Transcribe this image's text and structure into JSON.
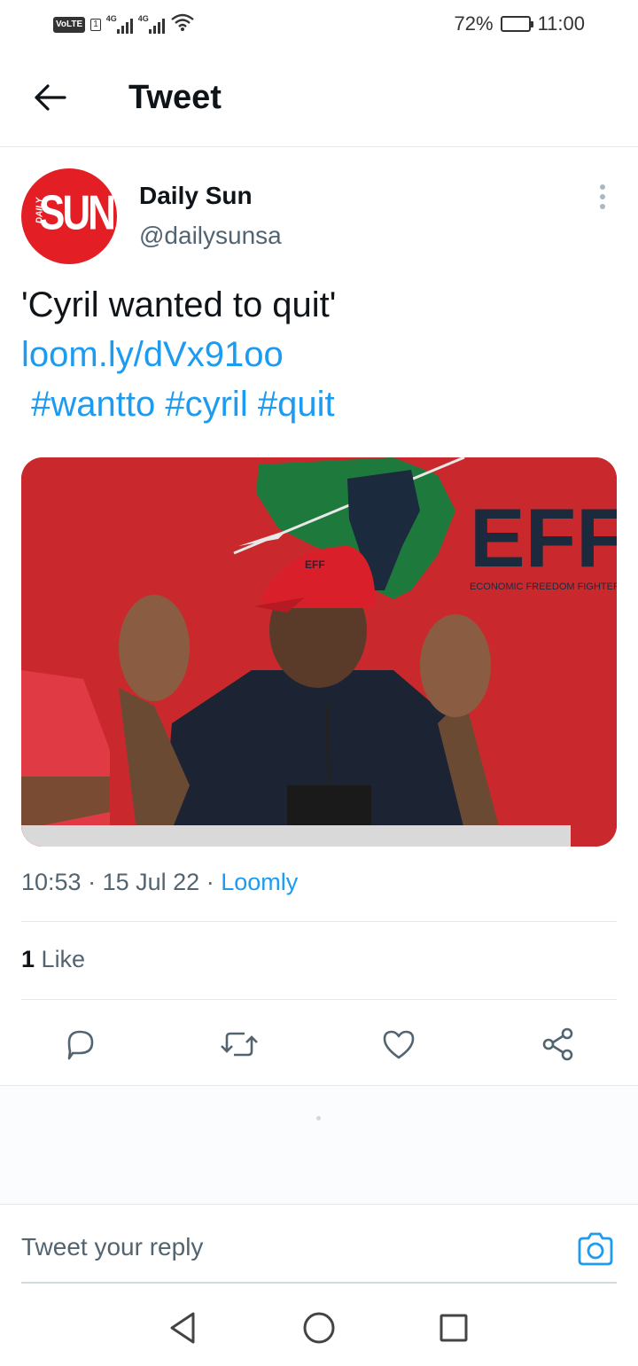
{
  "status_bar": {
    "volte": "VoLTE",
    "sim": "1",
    "net1": "4G",
    "net2": "4G",
    "battery": "72%",
    "battery_level": 0.72,
    "time": "11:00"
  },
  "header": {
    "title": "Tweet"
  },
  "author": {
    "avatar_top": "DAILY",
    "avatar_main": "SUN",
    "name": "Daily Sun",
    "handle": "@dailysunsa"
  },
  "tweet": {
    "text": "'Cyril wanted to quit'",
    "link": "loom.ly/dVx91oo",
    "hashtags": [
      "#wantto",
      "#cyril",
      "#quit"
    ],
    "image": {
      "banner_text": "EFF",
      "banner_subtext": "ECONOMIC FREEDOM FIGHTERS",
      "cap_text": "EFF"
    }
  },
  "meta": {
    "time": "10:53",
    "date": "15 Jul 22",
    "dot": "·",
    "source": "Loomly"
  },
  "engagement": {
    "like_count": "1",
    "like_label": "Like"
  },
  "actions": [
    "reply-icon",
    "retweet-icon",
    "like-icon",
    "share-icon"
  ],
  "reply": {
    "placeholder": "Tweet your reply"
  },
  "nav": [
    "back-triangle-icon",
    "home-circle-icon",
    "recents-square-icon"
  ],
  "colors": {
    "accent": "#1d9bf0",
    "brand_red": "#e31e24",
    "muted": "#536471"
  }
}
